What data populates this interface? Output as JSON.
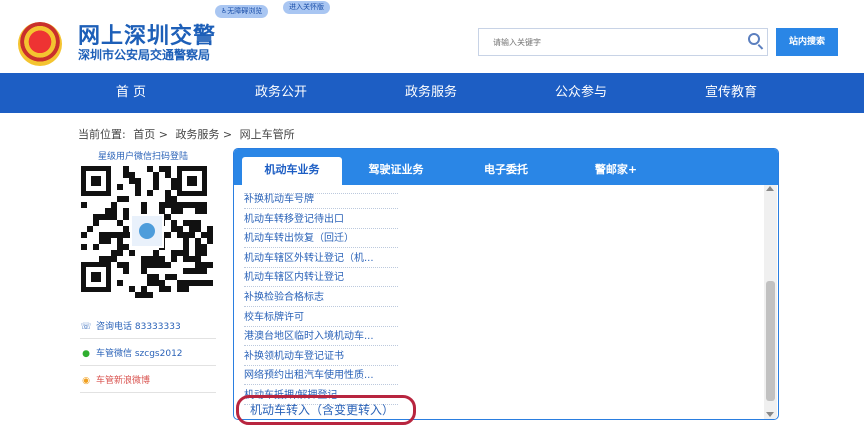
{
  "header": {
    "title": "网上深圳交警",
    "subtitle": "深圳市公安局交通警察局",
    "pill_access": "无障碍浏览",
    "pill_care": "进入关怀版",
    "search_placeholder": "请输入关键字",
    "search_button": "站内搜索"
  },
  "nav": [
    "首 页",
    "政务公开",
    "政务服务",
    "公众参与",
    "宣传教育"
  ],
  "breadcrumb": {
    "label": "当前位置:",
    "items": [
      "首页 >",
      "政务服务 >",
      "网上车管所"
    ]
  },
  "sidebar": {
    "qr_caption": "星级用户微信扫码登陆",
    "phone": "咨询电话 83333333",
    "wechat": "车管微信 szcgs2012",
    "weibo": "车管新浪微博"
  },
  "tabs": [
    "机动车业务",
    "驾驶证业务",
    "电子委托",
    "警邮家+"
  ],
  "list_items": [
    "补换机动车号牌",
    "机动车转移登记待出口",
    "机动车转出恢复（回迁）",
    "机动车辖区外转让登记（机...",
    "机动车辖区内转让登记",
    "补换检验合格标志",
    "校车标牌许可",
    "港澳台地区临时入境机动车...",
    "补换领机动车登记证书",
    "网络预约出租汽车使用性质...",
    "机动车抵押/解押登记"
  ],
  "highlighted_item": "机动车转入（含变更转入）",
  "colors": {
    "brand": "#1d5ec4",
    "accent": "#2a86e6",
    "highlight": "#b8253f"
  }
}
